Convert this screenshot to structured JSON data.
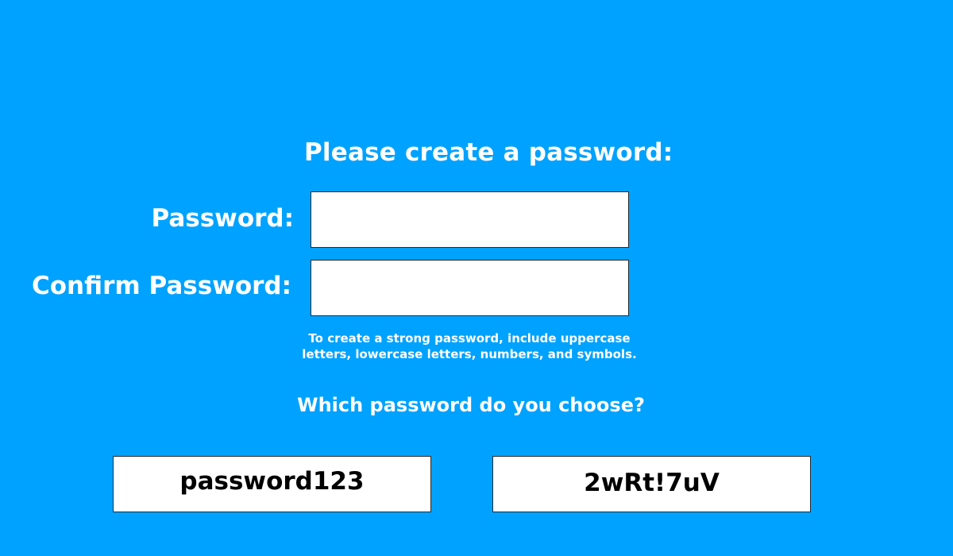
{
  "form": {
    "title": "Please create a password:",
    "password_label": "Password:",
    "password_value": "",
    "confirm_label": "Confirm Password:",
    "confirm_value": "",
    "hint": "To create a strong password, include uppercase letters, lowercase letters, numbers, and symbols."
  },
  "choice": {
    "question": "Which password do you choose?",
    "options": [
      {
        "label": "password123"
      },
      {
        "label": "2wRt!7uV"
      }
    ]
  },
  "colors": {
    "background": "#00a2ff",
    "text": "#ffffff",
    "field_background": "#ffffff",
    "field_border": "#2b2b2b"
  }
}
